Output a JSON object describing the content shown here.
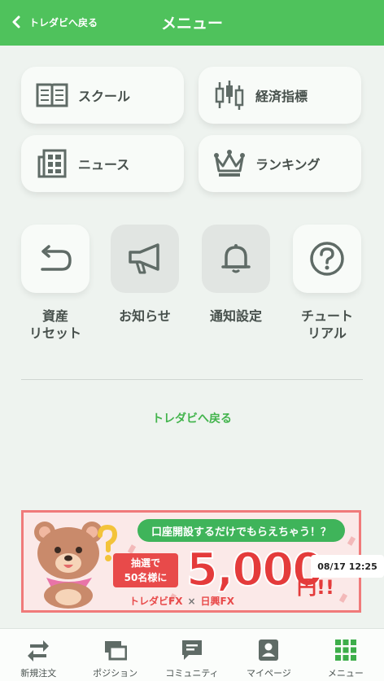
{
  "header": {
    "back_label": "トレダビへ戻る",
    "title": "メニュー"
  },
  "cards": [
    {
      "label": "スクール",
      "icon": "book-icon"
    },
    {
      "label": "経済指標",
      "icon": "candlestick-icon"
    },
    {
      "label": "ニュース",
      "icon": "newspaper-icon"
    },
    {
      "label": "ランキング",
      "icon": "crown-icon"
    }
  ],
  "squares": [
    {
      "label": "資産\nリセット",
      "icon": "reset-arrow-icon"
    },
    {
      "label": "お知らせ",
      "icon": "megaphone-icon"
    },
    {
      "label": "通知設定",
      "icon": "bell-icon"
    },
    {
      "label": "チュート\nリアル",
      "icon": "question-icon"
    }
  ],
  "return_link": "トレダビへ戻る",
  "banner": {
    "headline": "口座開設するだけでもらえちゃう！？",
    "lottery": "抽選で\n50名様に",
    "amount": "5,000",
    "yen": "円!!",
    "brand1": "トレダビFX",
    "times": "×",
    "brand2": "日興FX"
  },
  "timestamp": "08/17 12:25",
  "tabs": [
    {
      "label": "新規注文",
      "icon": "swap-arrows-icon"
    },
    {
      "label": "ポジション",
      "icon": "windows-icon"
    },
    {
      "label": "コミュニティ",
      "icon": "chat-icon"
    },
    {
      "label": "マイページ",
      "icon": "profile-icon"
    },
    {
      "label": "メニュー",
      "icon": "grid-icon",
      "active": true
    }
  ],
  "colors": {
    "accent": "#4fc25c",
    "icon": "#5f6b66",
    "tab_active": "#3dae4a"
  }
}
